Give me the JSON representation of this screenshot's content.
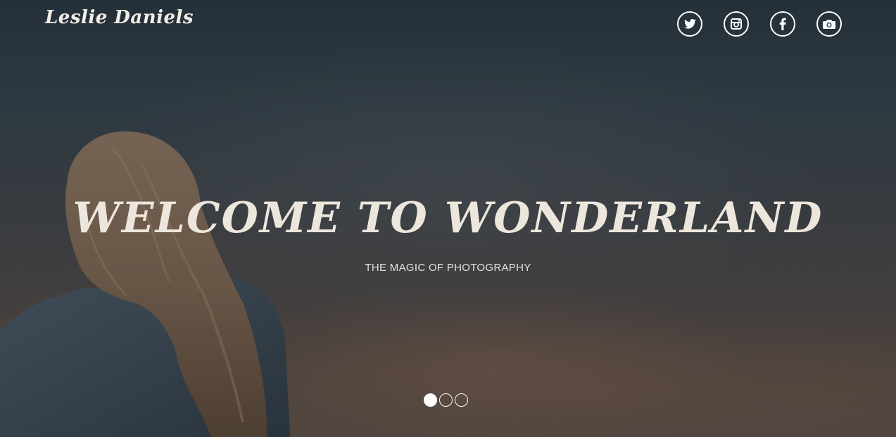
{
  "header": {
    "brand": "Leslie Daniels",
    "social": [
      {
        "name": "twitter",
        "icon": "twitter-icon"
      },
      {
        "name": "instagram",
        "icon": "instagram-icon"
      },
      {
        "name": "facebook",
        "icon": "facebook-icon"
      },
      {
        "name": "camera",
        "icon": "camera-icon"
      }
    ]
  },
  "hero": {
    "title": "WELCOME TO WONDERLAND",
    "subtitle": "THE MAGIC OF PHOTOGRAPHY",
    "slides": {
      "count": 3,
      "active": 1
    }
  },
  "colors": {
    "text_primary": "#ece6dc",
    "icon_border": "#ffffff",
    "background_top": "#283640",
    "background_bottom": "#5d5047"
  }
}
